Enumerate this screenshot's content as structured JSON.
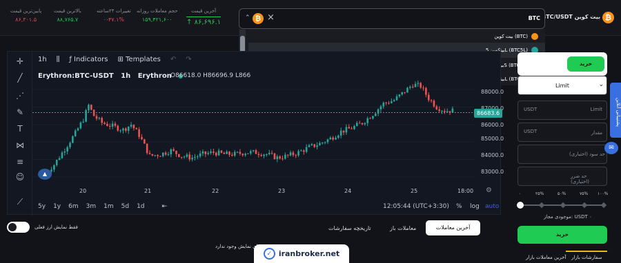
{
  "header": {
    "stats": [
      {
        "label": "پایین‌ترین قیمت",
        "value": "۸۶,۳۰۱.۵",
        "color": "#ef4458"
      },
      {
        "label": "بالاترین قیمت",
        "value": "۸۸,۷۶۵.۷",
        "color": "#1fcb52"
      },
      {
        "label": "تغییرات ۲۴ساعته",
        "value": "۰-۴۷.۱%",
        "color": "#ef4458"
      },
      {
        "label": "حجم معاملات روزانه",
        "value": "۱۵۹,۴۲۱,۶۰۰",
        "color": "#1fcb52"
      },
      {
        "label": "آخرین قیمت",
        "value": "۸۶,۶۹۶.۱",
        "color": "#1fcb52"
      }
    ],
    "last_price_arrow": "↑",
    "pair": "BTC/USDT بیت کوین",
    "coin_symbol": "₿"
  },
  "search": {
    "value": "BTC",
    "clear": "×",
    "chevron": "⌃",
    "results": [
      {
        "label": "بیت کوین (BTC)",
        "color": "#f7931a"
      },
      {
        "label": "بیتکوین 5L (BTC5L)",
        "color": "#26a69a"
      },
      {
        "label": "بیتکوین 5S (BTC5S)",
        "color": "#ef4458"
      },
      {
        "label": "بیتکوین 3L (BTC3L)",
        "color": "#26a69a"
      }
    ]
  },
  "chart_toolbar": {
    "interval": "1h",
    "indicators": "Indicators",
    "templates": "Templates",
    "undo": "↶",
    "redo": "↷"
  },
  "chart": {
    "ticker": "Erythron:BTC-USDT",
    "interval": "1h",
    "exchange": "Erythron",
    "ohlc": "O86618.0 H86696.9 L866",
    "current_price_label": "86683.6",
    "ranges": [
      "5y",
      "1y",
      "6m",
      "3m",
      "1m",
      "5d",
      "1d"
    ],
    "time": "12:05:44 (UTC+3:30)",
    "percent": "%",
    "log": "log",
    "auto": "auto"
  },
  "chart_data": {
    "type": "candlestick",
    "x_ticks": [
      "20",
      "21",
      "22",
      "23",
      "24",
      "25",
      "18:00"
    ],
    "y_ticks": [
      "88000.0",
      "87000.0",
      "86000.0",
      "85000.0",
      "84000.0",
      "83000.0"
    ],
    "ylim": [
      82600,
      88600
    ],
    "close_path": [
      [
        0,
        83100
      ],
      [
        4,
        83700
      ],
      [
        8,
        84600
      ],
      [
        12,
        85500
      ],
      [
        15,
        86300
      ],
      [
        17,
        87100
      ],
      [
        19,
        86500
      ],
      [
        22,
        86100
      ],
      [
        26,
        85900
      ],
      [
        30,
        85700
      ],
      [
        33,
        86000
      ],
      [
        36,
        85400
      ],
      [
        40,
        84200
      ],
      [
        44,
        84300
      ],
      [
        48,
        84500
      ],
      [
        52,
        84200
      ],
      [
        56,
        84100
      ],
      [
        60,
        84300
      ],
      [
        64,
        84400
      ],
      [
        68,
        84300
      ],
      [
        72,
        84300
      ],
      [
        76,
        84400
      ],
      [
        80,
        84400
      ],
      [
        84,
        84300
      ],
      [
        88,
        84100
      ],
      [
        92,
        84200
      ],
      [
        96,
        84400
      ],
      [
        100,
        84700
      ],
      [
        104,
        84900
      ],
      [
        108,
        85200
      ],
      [
        112,
        85600
      ],
      [
        116,
        85800
      ],
      [
        120,
        86100
      ],
      [
        124,
        86600
      ],
      [
        128,
        87200
      ],
      [
        132,
        87400
      ],
      [
        136,
        87900
      ],
      [
        139,
        88300
      ],
      [
        142,
        88200
      ],
      [
        145,
        87500
      ],
      [
        148,
        87000
      ],
      [
        151,
        86800
      ],
      [
        154,
        86800
      ]
    ],
    "last_price": 86683.6
  },
  "order_panel": {
    "buy_tab": "خرید",
    "order_type": "Limit",
    "price_unit": "USDT",
    "price_label": "Limit",
    "amount_unit": "USDT",
    "amount_label": "مقدار",
    "take_profit": "حد سود (اختیاری)",
    "stop_loss": "حد ضرر (اختیاری)",
    "percents": [
      "۰",
      "۲۵%",
      "۵۰%",
      "۷۵%",
      "۱۰۰%"
    ],
    "allowed": "موجودی مجاز: USDT ۰",
    "buy_button": "خرید",
    "bottom_tabs": [
      "سفارشات بازار",
      "آخرین معاملات بازار"
    ]
  },
  "online_support": "پشتیبانی آنلاین",
  "orders": {
    "tabs": [
      "آخرین معاملات",
      "معاملات باز",
      "تاریخچه سفارشات"
    ],
    "toggle_label": "فقط نمایش ارز فعلی",
    "empty": "موردی برای نمایش وجود ندارد."
  },
  "watermark": "iranbroker.net"
}
